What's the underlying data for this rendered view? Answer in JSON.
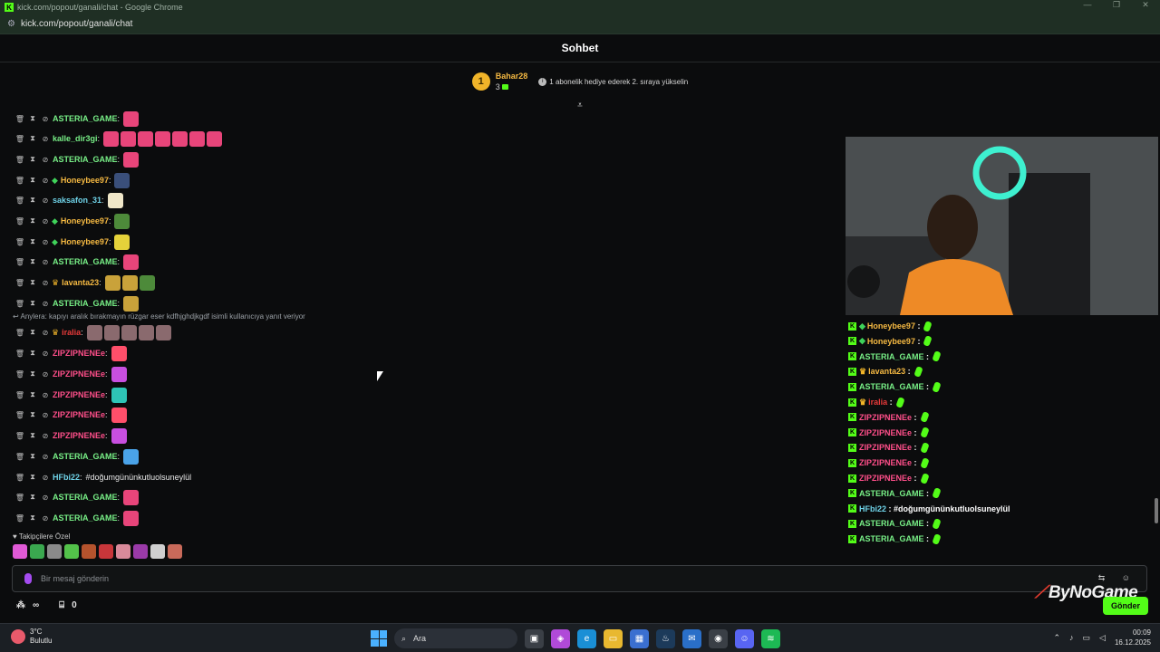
{
  "window": {
    "title": "kick.com/popout/ganali/chat - Google Chrome",
    "url": "kick.com/popout/ganali/chat",
    "controls": [
      "—",
      "❐",
      "✕"
    ]
  },
  "header": {
    "title": "Sohbet"
  },
  "leaderboard": {
    "rank": "1",
    "user": "Bahar28",
    "count": "3",
    "message": "1 abonelik hediye ederek 2. sıraya yükselin"
  },
  "chat": {
    "messages": [
      {
        "user": "ASTERIA_GAME",
        "color": "#78f087",
        "badge": "",
        "text": "",
        "emotes": [
          "#e8457a"
        ]
      },
      {
        "user": "kalle_dir3gi",
        "color": "#78f087",
        "badge": "",
        "text": "",
        "emotes": [
          "#e8457a",
          "#e8457a",
          "#e8457a",
          "#e8457a",
          "#e8457a",
          "#e8457a",
          "#e8457a"
        ]
      },
      {
        "user": "ASTERIA_GAME",
        "color": "#78f087",
        "badge": "",
        "text": "",
        "emotes": [
          "#e8457a"
        ]
      },
      {
        "user": "Honeybee97",
        "color": "#f5b942",
        "badge": "gem",
        "text": "",
        "emotes": [
          "#3a4f7a"
        ]
      },
      {
        "user": "saksafon_31",
        "color": "#6fd3e8",
        "badge": "",
        "text": "",
        "emotes": [
          "#efe6c8"
        ]
      },
      {
        "user": "Honeybee97",
        "color": "#f5b942",
        "badge": "gem",
        "text": "",
        "emotes": [
          "#4d8a3a"
        ]
      },
      {
        "user": "Honeybee97",
        "color": "#f5b942",
        "badge": "gem",
        "text": "",
        "emotes": [
          "#e5d23a"
        ]
      },
      {
        "user": "ASTERIA_GAME",
        "color": "#78f087",
        "badge": "",
        "text": "",
        "emotes": [
          "#e8457a"
        ]
      },
      {
        "user": "lavanta23",
        "color": "#f5b942",
        "badge": "crown",
        "text": "",
        "emotes": [
          "#c9a23a",
          "#c9a23a",
          "#4d8a3a"
        ]
      },
      {
        "user": "ASTERIA_GAME",
        "color": "#78f087",
        "badge": "",
        "text": "",
        "emotes": [
          "#c9a23a"
        ]
      },
      {
        "user": "iralia",
        "color": "#e83a3a",
        "badge": "crown",
        "text": "",
        "emotes": [
          "#8a6a6e",
          "#8a6a6e",
          "#8a6a6e",
          "#8a6a6e",
          "#8a6a6e"
        ]
      },
      {
        "user": "ZIPZIPNENEe",
        "color": "#ff4f8a",
        "badge": "",
        "text": "",
        "emotes": [
          "#ff4f6a"
        ]
      },
      {
        "user": "ZIPZIPNENEe",
        "color": "#ff4f8a",
        "badge": "",
        "text": "",
        "emotes": [
          "#c84fe0"
        ]
      },
      {
        "user": "ZIPZIPNENEe",
        "color": "#ff4f8a",
        "badge": "",
        "text": "",
        "emotes": [
          "#2ec4b6"
        ]
      },
      {
        "user": "ZIPZIPNENEe",
        "color": "#ff4f8a",
        "badge": "",
        "text": "",
        "emotes": [
          "#ff4f6a"
        ]
      },
      {
        "user": "ZIPZIPNENEe",
        "color": "#ff4f8a",
        "badge": "",
        "text": "",
        "emotes": [
          "#c84fe0"
        ]
      },
      {
        "user": "ASTERIA_GAME",
        "color": "#78f087",
        "badge": "",
        "text": "",
        "emotes": [
          "#4aa3e8"
        ]
      },
      {
        "user": "HFbi22",
        "color": "#6fd3e8",
        "badge": "",
        "text": "#doğumgününkutluolsuneylül",
        "emotes": []
      },
      {
        "user": "ASTERIA_GAME",
        "color": "#78f087",
        "badge": "",
        "text": "",
        "emotes": [
          "#e8457a"
        ]
      },
      {
        "user": "ASTERIA_GAME",
        "color": "#78f087",
        "badge": "",
        "text": "",
        "emotes": [
          "#e8457a"
        ]
      }
    ],
    "reply_note": "Anylera: kapıyı aralık bırakmayın rüzgar eser kdfhjghdjkgdf isimli kullanıcıya yanıt veriyor"
  },
  "followers_label": "Takipçilere Özel",
  "emote_bar": [
    "#e05ad6",
    "#3aa84f",
    "#8a8a8a",
    "#53c24a",
    "#b5532d",
    "#c8363a",
    "#d98a9a",
    "#9a3aa8",
    "#cfcfcf",
    "#c96a5a"
  ],
  "input": {
    "placeholder": "Bir mesaj gönderin",
    "icons": "⇆ ☺"
  },
  "bottom": {
    "infinity": "∞",
    "gift_count": "0"
  },
  "send_label": "Gönder",
  "brand_overlay": "ByNoGame",
  "overlay_chat": [
    {
      "user": "Honeybee97",
      "color": "#f5b942",
      "badge": "gem",
      "text": ""
    },
    {
      "user": "Honeybee97",
      "color": "#f5b942",
      "badge": "gem",
      "text": ""
    },
    {
      "user": "ASTERIA_GAME",
      "color": "#78f087",
      "badge": "",
      "text": ""
    },
    {
      "user": "lavanta23",
      "color": "#f5b942",
      "badge": "crown",
      "text": ""
    },
    {
      "user": "ASTERIA_GAME",
      "color": "#78f087",
      "badge": "",
      "text": ""
    },
    {
      "user": "iralia",
      "color": "#e83a3a",
      "badge": "crown",
      "text": ""
    },
    {
      "user": "ZIPZIPNENEe",
      "color": "#ff4f8a",
      "badge": "",
      "text": ""
    },
    {
      "user": "ZIPZIPNENEe",
      "color": "#ff4f8a",
      "badge": "",
      "text": ""
    },
    {
      "user": "ZIPZIPNENEe",
      "color": "#ff4f8a",
      "badge": "",
      "text": ""
    },
    {
      "user": "ZIPZIPNENEe",
      "color": "#ff4f8a",
      "badge": "",
      "text": ""
    },
    {
      "user": "ZIPZIPNENEe",
      "color": "#ff4f8a",
      "badge": "",
      "text": ""
    },
    {
      "user": "ASTERIA_GAME",
      "color": "#78f087",
      "badge": "",
      "text": ""
    },
    {
      "user": "HFbi22",
      "color": "#6fd3e8",
      "badge": "",
      "text": "#doğumgününkutluolsuneylül"
    },
    {
      "user": "ASTERIA_GAME",
      "color": "#78f087",
      "badge": "",
      "text": ""
    },
    {
      "user": "ASTERIA_GAME",
      "color": "#78f087",
      "badge": "",
      "text": ""
    }
  ],
  "taskbar": {
    "weather_temp": "3°C",
    "weather_desc": "Bulutlu",
    "search_label": "Ara",
    "time": "00:09",
    "date": "16.12.2025"
  }
}
